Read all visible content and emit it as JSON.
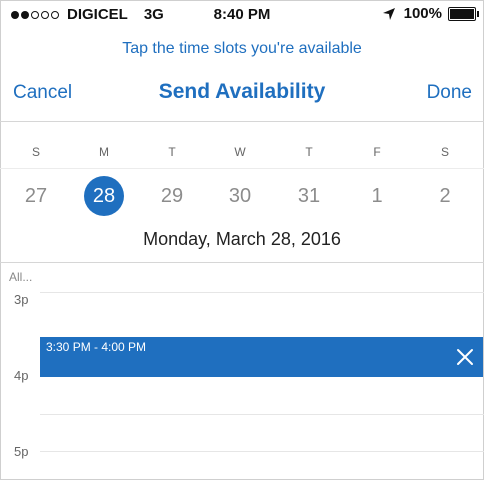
{
  "status_bar": {
    "carrier": "DIGICEL",
    "network": "3G",
    "signal_bars_filled": 2,
    "signal_bars_total": 5,
    "time": "8:40 PM",
    "battery": "100%",
    "battery_fill": 1.0,
    "location_icon": "location-arrow-icon",
    "battery_icon": "battery-icon"
  },
  "header": {
    "hint": "Tap the time slots you're available",
    "cancel_label": "Cancel",
    "title": "Send Availability",
    "done_label": "Done"
  },
  "week": {
    "days": [
      {
        "letter": "S",
        "date": "27",
        "selected": false
      },
      {
        "letter": "M",
        "date": "28",
        "selected": true
      },
      {
        "letter": "T",
        "date": "29",
        "selected": false
      },
      {
        "letter": "W",
        "date": "30",
        "selected": false
      },
      {
        "letter": "T",
        "date": "31",
        "selected": false
      },
      {
        "letter": "F",
        "date": "1",
        "selected": false
      },
      {
        "letter": "S",
        "date": "2",
        "selected": false
      }
    ],
    "selected_day_title": "Monday, March 28, 2016"
  },
  "timeline": {
    "all_day_label": "All...",
    "hours": [
      "3p",
      "4p",
      "5p"
    ],
    "selected_slot": {
      "label": "3:30 PM - 4:00 PM",
      "remove_icon": "close-icon"
    }
  },
  "colors": {
    "accent": "#1f6fbf",
    "date_inactive": "#8c8c8c",
    "grid": "#e6e6e6"
  }
}
